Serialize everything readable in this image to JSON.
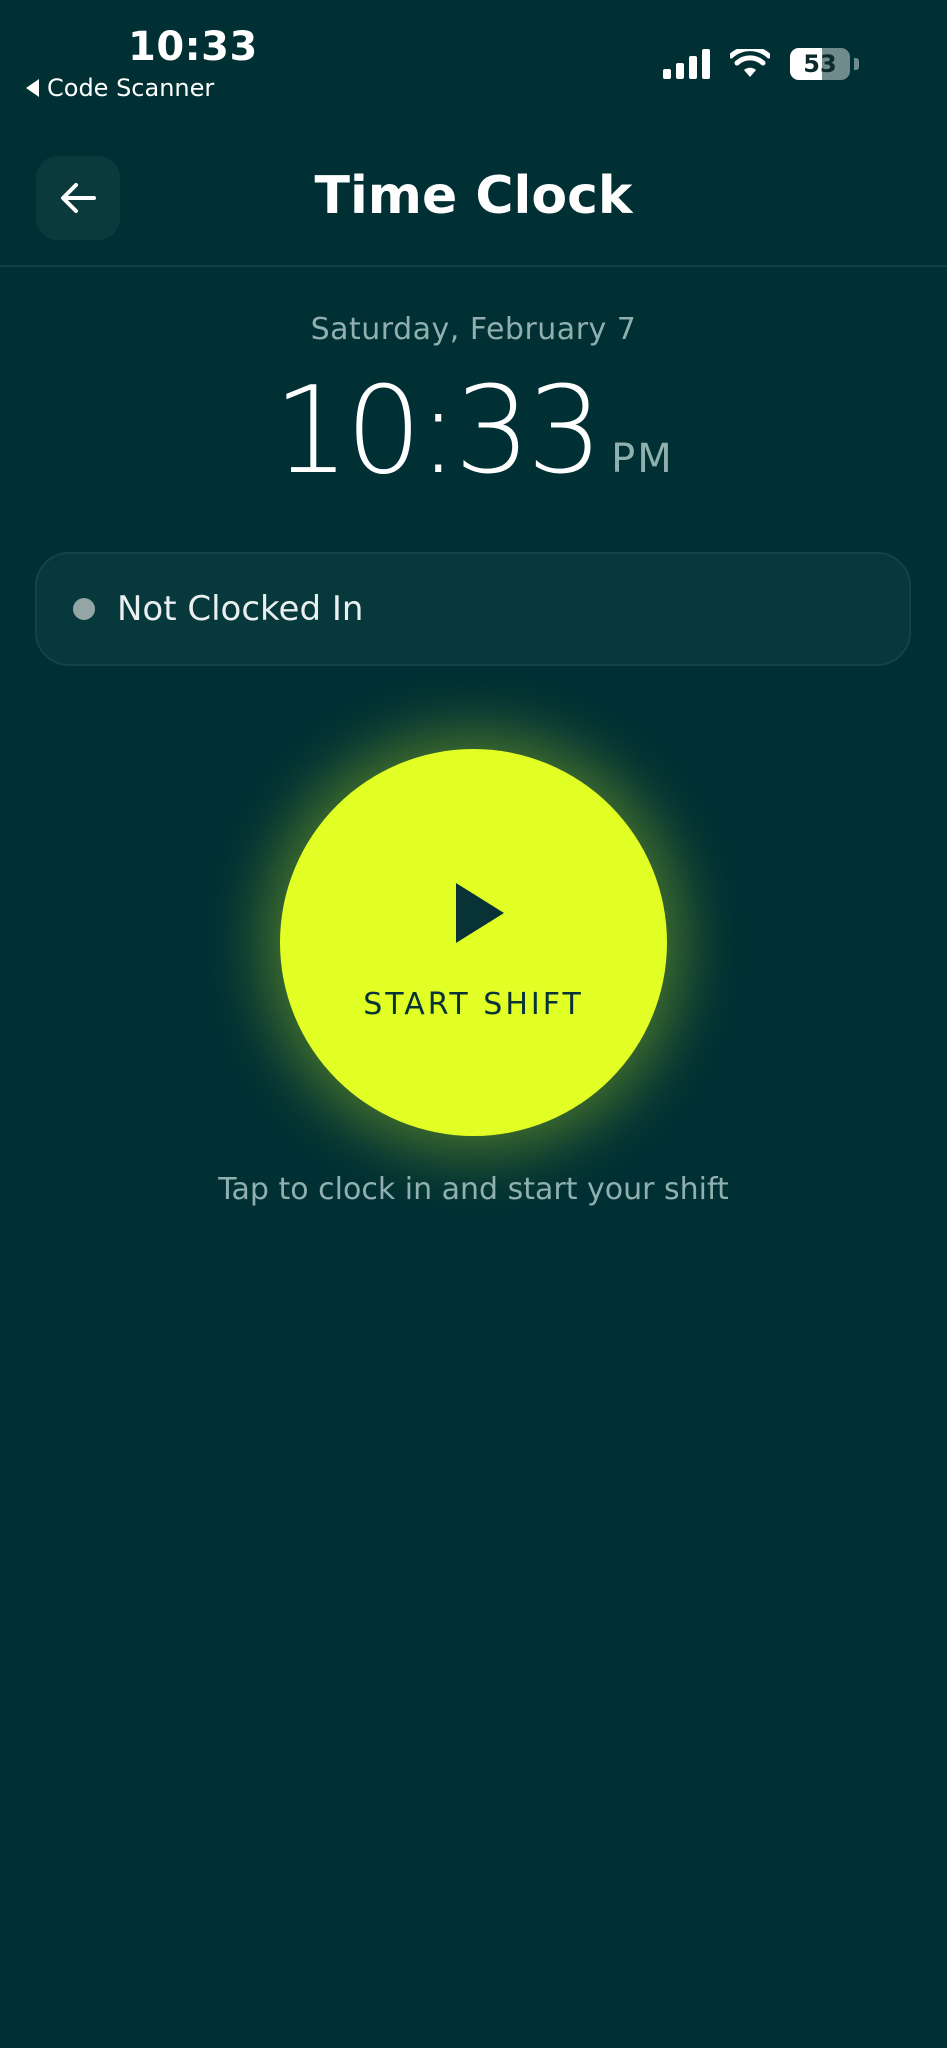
{
  "status_bar": {
    "time": "10:33",
    "back_app_label": "Code Scanner",
    "battery_level": "53",
    "icons": [
      "cellular-signal-icon",
      "wifi-icon",
      "battery-icon"
    ]
  },
  "header": {
    "title": "Time Clock",
    "back_icon": "arrow-left-icon"
  },
  "datetime": {
    "date": "Saturday, February 7",
    "time": "10:33",
    "ampm": "PM"
  },
  "status_card": {
    "text": "Not Clocked In",
    "dot_color": "#93a5a5"
  },
  "start_button": {
    "label": "START SHIFT",
    "icon": "play-icon",
    "color": "#e2ff25"
  },
  "hint": "Tap to clock in and start your shift",
  "colors": {
    "background": "#003034",
    "accent": "#e2ff25",
    "muted_text": "#8fb0ae"
  }
}
